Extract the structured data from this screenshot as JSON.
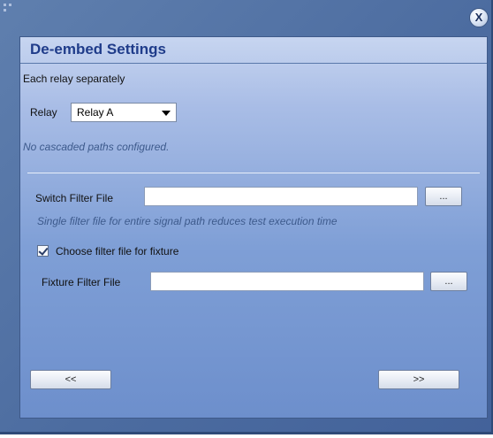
{
  "window": {
    "close_label": "X"
  },
  "panel": {
    "title": "De-embed Settings",
    "relay_section": {
      "heading": "Each relay separately",
      "relay_label": "Relay",
      "relay_selected": "Relay A",
      "no_paths_text": "No cascaded paths configured."
    },
    "switch_filter": {
      "label": "Switch Filter File",
      "value": "",
      "browse_label": "...",
      "hint": "Single filter file for entire signal path reduces test execution time"
    },
    "fixture_checkbox": {
      "label": "Choose filter file for fixture",
      "checked": true
    },
    "fixture_filter": {
      "label": "Fixture Filter File",
      "value": "",
      "browse_label": "..."
    },
    "nav": {
      "back_label": "<<",
      "next_label": ">>"
    }
  },
  "colors": {
    "window_bg": "#5474a8",
    "panel_top": "#c7d5f0",
    "panel_bottom": "#6d8fcc",
    "title_text": "#1f3c8a",
    "hint_text": "#3d5a8c"
  }
}
